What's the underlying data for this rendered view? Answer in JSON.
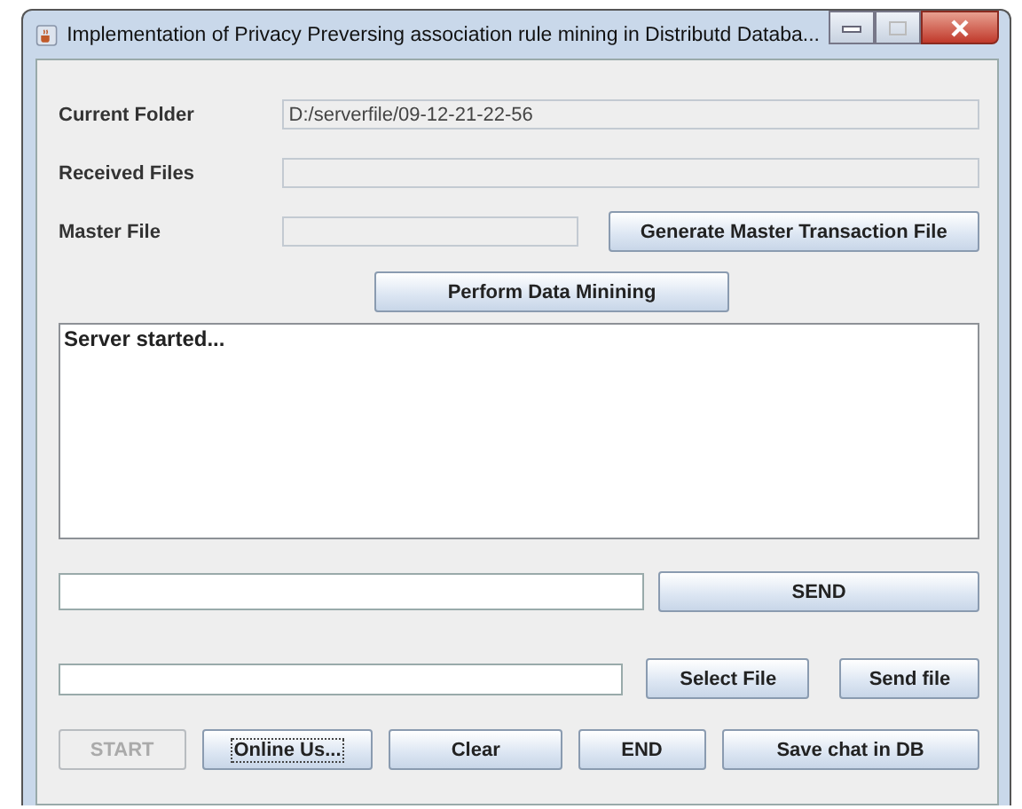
{
  "window": {
    "title": "Implementation of Privacy Preversing association rule mining in Distributd Databa..."
  },
  "fields": [
    {
      "label": "Current Folder",
      "value": "D:/serverfile/09-12-21-22-56"
    },
    {
      "label": "Received Files"
    }
  ],
  "master": {
    "label": "Master File",
    "button": "Generate Master Transaction File"
  },
  "mine_button": "Perform Data Minining",
  "log": [
    "Server started..."
  ],
  "send_button": "SEND",
  "file_buttons": [
    "Select File",
    "Send file"
  ],
  "bottom_buttons": [
    {
      "label": "START",
      "disabled": true,
      "focused": false
    },
    {
      "label": "Online Us...",
      "disabled": false,
      "focused": true
    },
    {
      "label": "Clear",
      "disabled": false,
      "focused": false
    },
    {
      "label": "END",
      "disabled": false,
      "focused": false
    },
    {
      "label": "Save chat in DB",
      "disabled": false,
      "focused": false
    }
  ]
}
